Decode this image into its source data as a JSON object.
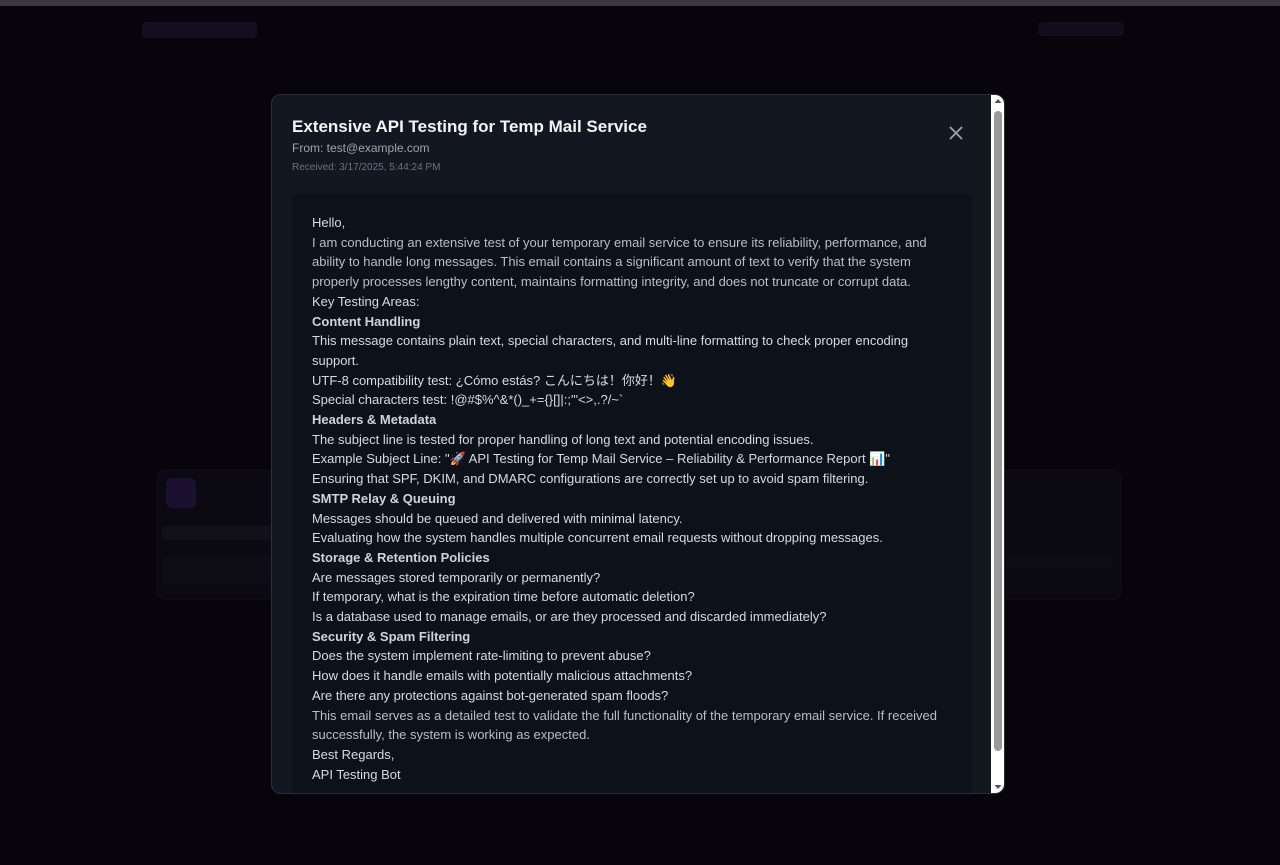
{
  "email": {
    "subject": "Extensive API Testing for Temp Mail Service",
    "from": "From: test@example.com",
    "received": "Received: 3/17/2025, 5:44:24 PM"
  },
  "icons": {
    "close": "close-icon",
    "scroll_up": "scroll-up-arrow-icon",
    "scroll_down": "scroll-down-arrow-icon"
  },
  "body_lines": [
    "Hello,",
    "I am conducting an extensive test of your temporary email service to ensure its reliability, performance, and",
    "ability to handle long messages. This email contains a significant amount of text to verify that the system",
    "properly processes lengthy content, maintains formatting integrity, and does not truncate or corrupt data.",
    "Key Testing Areas:",
    "Content Handling",
    "This message contains plain text, special characters, and multi-line formatting to check proper encoding",
    "support.",
    "UTF-8 compatibility test: ¿Cómo estás? こんにちは！你好！👋",
    "Special characters test: !@#$%^&*()_+={}[]|:;\"'<>,.?/~`",
    "Headers & Metadata",
    "The subject line is tested for proper handling of long text and potential encoding issues.",
    "Example Subject Line: \"🚀 API Testing for Temp Mail Service – Reliability & Performance Report 📊\"",
    "Ensuring that SPF, DKIM, and DMARC configurations are correctly set up to avoid spam filtering.",
    "SMTP Relay & Queuing",
    "Messages should be queued and delivered with minimal latency.",
    "Evaluating how the system handles multiple concurrent email requests without dropping messages.",
    "Storage & Retention Policies",
    "Are messages stored temporarily or permanently?",
    "If temporary, what is the expiration time before automatic deletion?",
    "Is a database used to manage emails, or are they processed and discarded immediately?",
    "Security & Spam Filtering",
    "Does the system implement rate-limiting to prevent abuse?",
    "How does it handle emails with potentially malicious attachments?",
    "Are there any protections against bot-generated spam floods?",
    "This email serves as a detailed test to validate the full functionality of the temporary email service. If received",
    "successfully, the system is working as expected.",
    "Best Regards,",
    "API Testing Bot"
  ]
}
